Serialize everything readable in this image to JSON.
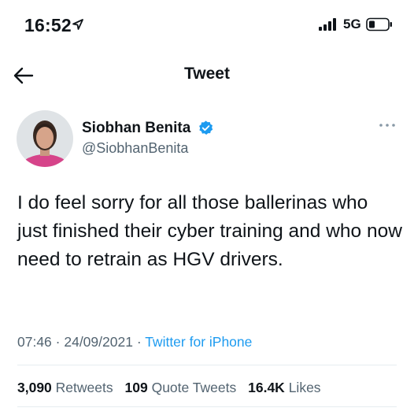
{
  "status_bar": {
    "time": "16:52",
    "network": "5G"
  },
  "header": {
    "title": "Tweet"
  },
  "tweet": {
    "author": {
      "name": "Siobhan Benita",
      "handle": "@SiobhanBenita",
      "verified": true
    },
    "text": "I do feel sorry for all those ballerinas who just finished their cyber training and who now need to retrain as HGV drivers.",
    "time": "07:46",
    "date": "24/09/2021",
    "separator": " · ",
    "source": "Twitter for iPhone",
    "stats": {
      "retweets_count": "3,090",
      "retweets_label": "Retweets",
      "quotes_count": "109",
      "quotes_label": "Quote Tweets",
      "likes_count": "16.4K",
      "likes_label": "Likes"
    }
  },
  "colors": {
    "accent": "#1d9bf0",
    "text_primary": "#0f1419",
    "text_secondary": "#536471",
    "divider": "#e6ecf0"
  },
  "icons": [
    "location-arrow-icon",
    "signal-icon",
    "battery-icon",
    "back-arrow-icon",
    "verified-badge-icon",
    "more-options-icon"
  ]
}
